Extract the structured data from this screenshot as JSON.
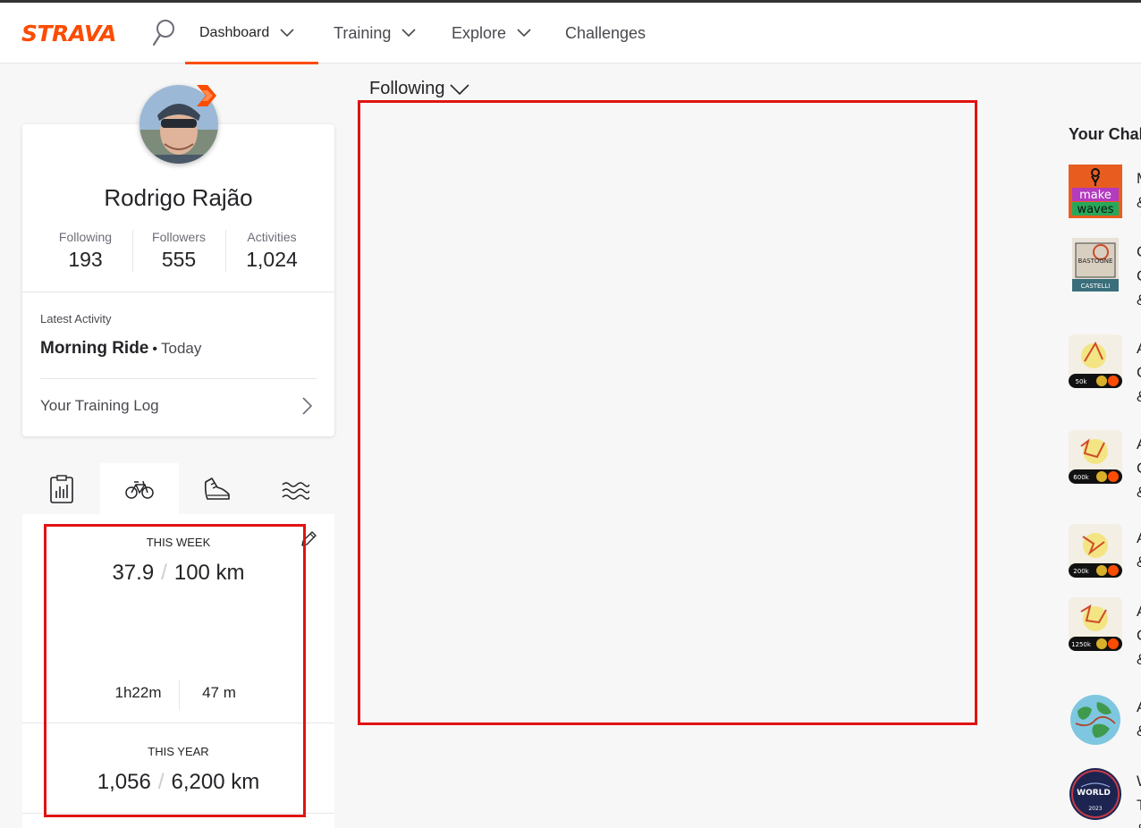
{
  "header": {
    "logo": "STRAVA",
    "nav": [
      {
        "label": "Dashboard"
      },
      {
        "label": "Training"
      },
      {
        "label": "Explore"
      },
      {
        "label": "Challenges"
      }
    ]
  },
  "profile": {
    "name": "Rodrigo Rajão",
    "stats": [
      {
        "label": "Following",
        "value": "193"
      },
      {
        "label": "Followers",
        "value": "555"
      },
      {
        "label": "Activities",
        "value": "1,024"
      }
    ],
    "latest_activity_label": "Latest Activity",
    "latest_activity_name": "Morning Ride",
    "latest_activity_separator": "•",
    "latest_activity_when": "Today",
    "training_log_label": "Your Training Log"
  },
  "sport_tabs": [
    {
      "icon": "clipboard-icon"
    },
    {
      "icon": "bike-icon",
      "active": true
    },
    {
      "icon": "shoe-icon"
    },
    {
      "icon": "swim-icon"
    }
  ],
  "week": {
    "label": "THIS WEEK",
    "current": "37.9",
    "goal": "100 km",
    "time": "1h22m",
    "elevation": "47 m"
  },
  "year": {
    "label": "THIS YEAR",
    "current": "1,056",
    "goal": "6,200 km"
  },
  "feed": {
    "filter_label": "Following"
  },
  "challenges": {
    "title": "Your Chal",
    "items": [
      {
        "badge_text_1": "make",
        "badge_text_2": "waves",
        "text": [
          "M",
          "&"
        ]
      },
      {
        "badge_text_1": "BASTOGNE",
        "badge_text_2": "CASTELLI",
        "text": [
          "C",
          "C",
          "&"
        ]
      },
      {
        "badge_text_1": "50k",
        "text": [
          "A",
          "C",
          "&"
        ]
      },
      {
        "badge_text_1": "600k",
        "text": [
          "A",
          "C",
          "&"
        ]
      },
      {
        "badge_text_1": "200k",
        "text": [
          "A",
          "&"
        ]
      },
      {
        "badge_text_1": "1250k",
        "text": [
          "A",
          "C",
          "&"
        ]
      },
      {
        "text": [
          "A",
          "&"
        ]
      },
      {
        "badge_text_1": "WORLD",
        "badge_text_2": "2023",
        "text": [
          "W",
          "T",
          "&"
        ]
      }
    ]
  }
}
